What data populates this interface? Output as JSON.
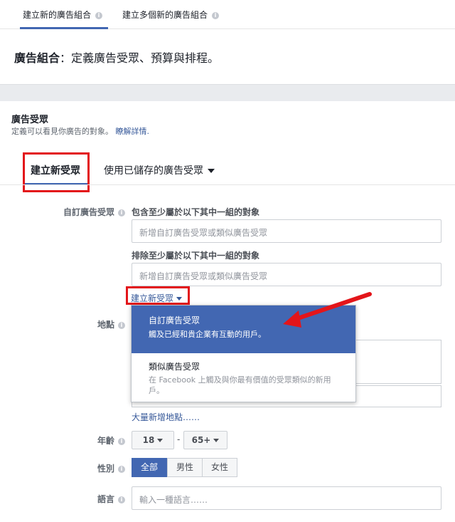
{
  "tabs": [
    {
      "label": "建立新的廣告組合",
      "active": true
    },
    {
      "label": "建立多個新的廣告組合",
      "active": false
    }
  ],
  "page": {
    "title_bold": "廣告組合",
    "title_rest": "：定義廣告受眾、預算與排程。"
  },
  "audience_section": {
    "title": "廣告受眾",
    "description": "定義可以看見你廣告的對象。",
    "learn_more": "瞭解詳情."
  },
  "audience_tabs": {
    "create_new": "建立新受眾",
    "use_saved": "使用已儲存的廣告受眾"
  },
  "custom_audience": {
    "label": "自訂廣告受眾",
    "include_label": "包含至少屬於以下其中一組的對象",
    "include_placeholder": "新增自訂廣告受眾或類似廣告受眾",
    "exclude_label": "排除至少屬於以下其中一組的對象",
    "exclude_placeholder": "新增自訂廣告受眾或類似廣告受眾",
    "create_new_link": "建立新受眾"
  },
  "dropdown": {
    "items": [
      {
        "title": "自訂廣告受眾",
        "desc": "觸及已經和貴企業有互動的用戶。"
      },
      {
        "title": "類似廣告受眾",
        "desc": "在 Facebook 上觸及與你最有價值的受眾類似的新用戶。"
      }
    ]
  },
  "location": {
    "label": "地點",
    "bulk_add": "大量新增地點……"
  },
  "age": {
    "label": "年齡",
    "min": "18",
    "max": "65+",
    "separator": "-"
  },
  "gender": {
    "label": "性別",
    "options": [
      "全部",
      "男性",
      "女性"
    ],
    "selected": "全部"
  },
  "language": {
    "label": "語言",
    "placeholder": "輸入一種語言……"
  },
  "colors": {
    "accent": "#4267b2",
    "highlight_box": "#e3151a",
    "link": "#365899"
  }
}
